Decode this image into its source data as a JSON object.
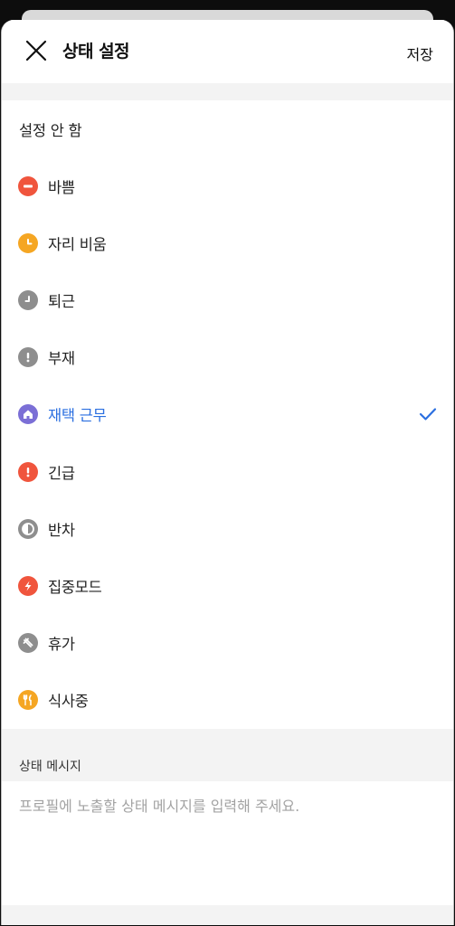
{
  "header": {
    "title": "상태 설정",
    "save_label": "저장"
  },
  "statuses": [
    {
      "label": "설정 안 함",
      "icon": "none",
      "color": ""
    },
    {
      "label": "바쁨",
      "icon": "minus-circle-icon",
      "color": "#f0553d"
    },
    {
      "label": "자리 비움",
      "icon": "clock-icon",
      "color": "#f5a623"
    },
    {
      "label": "퇴근",
      "icon": "clock-icon",
      "color": "#8e8e8e"
    },
    {
      "label": "부재",
      "icon": "exclamation-icon",
      "color": "#8e8e8e"
    },
    {
      "label": "재택 근무",
      "icon": "home-icon",
      "color": "#7b6fd6",
      "selected": true
    },
    {
      "label": "긴급",
      "icon": "exclamation-icon",
      "color": "#f0553d"
    },
    {
      "label": "반차",
      "icon": "half-circle-icon",
      "color": "#8e8e8e"
    },
    {
      "label": "집중모드",
      "icon": "lightning-icon",
      "color": "#f0553d"
    },
    {
      "label": "휴가",
      "icon": "airplane-icon",
      "color": "#8e8e8e"
    },
    {
      "label": "식사중",
      "icon": "fork-knife-icon",
      "color": "#f5a623"
    }
  ],
  "message": {
    "section_label": "상태 메시지",
    "placeholder": "프로필에 노출할 상태 메시지를 입력해 주세요.",
    "value": ""
  },
  "colors": {
    "accent": "#2b6fe0"
  }
}
